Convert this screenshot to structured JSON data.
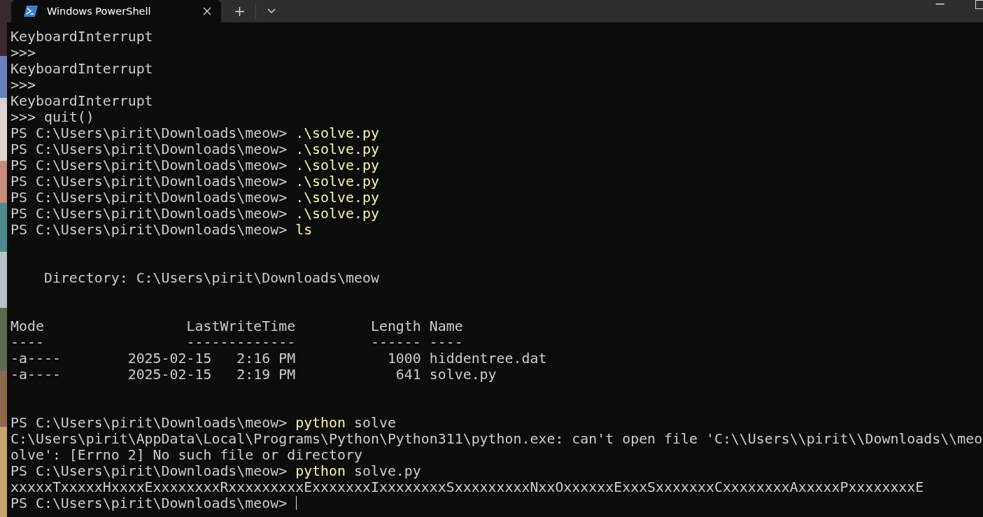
{
  "window": {
    "tab": {
      "title": "Windows PowerShell",
      "selected": true
    }
  },
  "lines": [
    {
      "kind": "text",
      "segments": [
        {
          "kind": "plain",
          "text": "KeyboardInterrupt"
        }
      ]
    },
    {
      "kind": "text",
      "segments": [
        {
          "kind": "plain",
          "text": ">>>"
        }
      ]
    },
    {
      "kind": "text",
      "segments": [
        {
          "kind": "plain",
          "text": "KeyboardInterrupt"
        }
      ]
    },
    {
      "kind": "text",
      "segments": [
        {
          "kind": "plain",
          "text": ">>>"
        }
      ]
    },
    {
      "kind": "text",
      "segments": [
        {
          "kind": "plain",
          "text": "KeyboardInterrupt"
        }
      ]
    },
    {
      "kind": "text",
      "segments": [
        {
          "kind": "plain",
          "text": ">>> quit()"
        }
      ]
    },
    {
      "kind": "text",
      "segments": [
        {
          "kind": "plain",
          "text": "PS C:\\Users\\pirit\\Downloads\\meow> "
        },
        {
          "kind": "command",
          "text": ".\\solve.py"
        }
      ]
    },
    {
      "kind": "text",
      "segments": [
        {
          "kind": "plain",
          "text": "PS C:\\Users\\pirit\\Downloads\\meow> "
        },
        {
          "kind": "command",
          "text": ".\\solve.py"
        }
      ]
    },
    {
      "kind": "text",
      "segments": [
        {
          "kind": "plain",
          "text": "PS C:\\Users\\pirit\\Downloads\\meow> "
        },
        {
          "kind": "command",
          "text": ".\\solve.py"
        }
      ]
    },
    {
      "kind": "text",
      "segments": [
        {
          "kind": "plain",
          "text": "PS C:\\Users\\pirit\\Downloads\\meow> "
        },
        {
          "kind": "command",
          "text": ".\\solve.py"
        }
      ]
    },
    {
      "kind": "text",
      "segments": [
        {
          "kind": "plain",
          "text": "PS C:\\Users\\pirit\\Downloads\\meow> "
        },
        {
          "kind": "command",
          "text": ".\\solve.py"
        }
      ]
    },
    {
      "kind": "text",
      "segments": [
        {
          "kind": "plain",
          "text": "PS C:\\Users\\pirit\\Downloads\\meow> "
        },
        {
          "kind": "command",
          "text": ".\\solve.py"
        }
      ]
    },
    {
      "kind": "text",
      "segments": [
        {
          "kind": "plain",
          "text": "PS C:\\Users\\pirit\\Downloads\\meow> "
        },
        {
          "kind": "command",
          "text": "ls"
        }
      ]
    },
    {
      "kind": "blank"
    },
    {
      "kind": "blank"
    },
    {
      "kind": "text",
      "segments": [
        {
          "kind": "plain",
          "text": "    Directory: C:\\Users\\pirit\\Downloads\\meow"
        }
      ]
    },
    {
      "kind": "blank"
    },
    {
      "kind": "blank"
    },
    {
      "kind": "text",
      "segments": [
        {
          "kind": "plain",
          "text": "Mode                 LastWriteTime         Length Name"
        }
      ]
    },
    {
      "kind": "text",
      "segments": [
        {
          "kind": "plain",
          "text": "----                 -------------         ------ ----"
        }
      ]
    },
    {
      "kind": "text",
      "segments": [
        {
          "kind": "plain",
          "text": "-a----        2025-02-15   2:16 PM           1000 hiddentree.dat"
        }
      ]
    },
    {
      "kind": "text",
      "segments": [
        {
          "kind": "plain",
          "text": "-a----        2025-02-15   2:19 PM            641 solve.py"
        }
      ]
    },
    {
      "kind": "blank"
    },
    {
      "kind": "blank"
    },
    {
      "kind": "text",
      "segments": [
        {
          "kind": "plain",
          "text": "PS C:\\Users\\pirit\\Downloads\\meow> "
        },
        {
          "kind": "command",
          "text": "python"
        },
        {
          "kind": "plain",
          "text": " solve"
        }
      ]
    },
    {
      "kind": "text",
      "segments": [
        {
          "kind": "plain",
          "text": "C:\\Users\\pirit\\AppData\\Local\\Programs\\Python\\Python311\\python.exe: can't open file 'C:\\\\Users\\\\pirit\\\\Downloads\\\\meo"
        }
      ]
    },
    {
      "kind": "text",
      "segments": [
        {
          "kind": "plain",
          "text": "olve': [Errno 2] No such file or directory"
        }
      ]
    },
    {
      "kind": "text",
      "segments": [
        {
          "kind": "plain",
          "text": "PS C:\\Users\\pirit\\Downloads\\meow> "
        },
        {
          "kind": "command",
          "text": "python"
        },
        {
          "kind": "plain",
          "text": " solve.py"
        }
      ]
    },
    {
      "kind": "text",
      "segments": [
        {
          "kind": "plain",
          "text": "xxxxxTxxxxxHxxxxExxxxxxxxRxxxxxxxxxExxxxxxxIxxxxxxxxSxxxxxxxxxNxxOxxxxxxExxxSxxxxxxxCxxxxxxxxAxxxxxPxxxxxxxxE"
        }
      ]
    },
    {
      "kind": "text",
      "cursor": true,
      "segments": [
        {
          "kind": "plain",
          "text": "PS C:\\Users\\pirit\\Downloads\\meow> "
        }
      ]
    }
  ]
}
